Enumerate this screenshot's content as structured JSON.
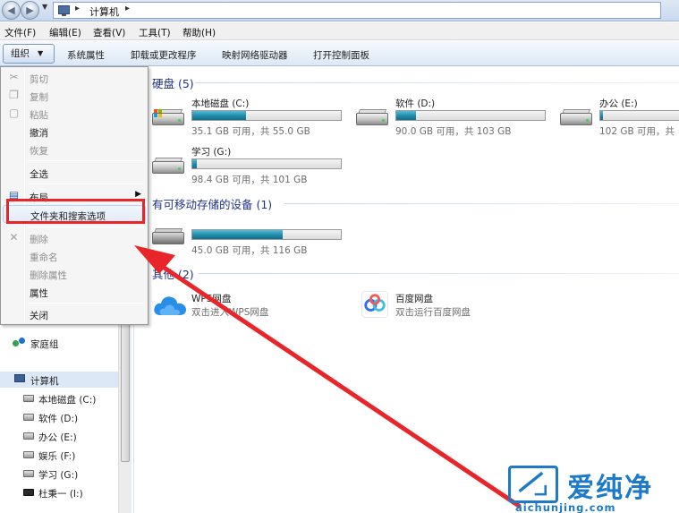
{
  "address_bar": {
    "location": "计算机",
    "separator": "▸"
  },
  "menubar": {
    "items": [
      "文件(F)",
      "编辑(E)",
      "查看(V)",
      "工具(T)",
      "帮助(H)"
    ]
  },
  "toolbar": {
    "organize_label": "组织",
    "buttons": [
      "系统属性",
      "卸载或更改程序",
      "映射网络驱动器",
      "打开控制面板"
    ]
  },
  "context_menu": {
    "items": [
      {
        "label": "剪切",
        "enabled": false,
        "icon": "scissors-icon"
      },
      {
        "label": "复制",
        "enabled": false,
        "icon": "copy-icon"
      },
      {
        "label": "粘贴",
        "enabled": false,
        "icon": "paste-icon"
      },
      {
        "label": "撤消",
        "enabled": true
      },
      {
        "label": "恢复",
        "enabled": false
      },
      {
        "label": "全选",
        "enabled": true
      },
      {
        "label": "布局",
        "enabled": true,
        "submenu": true,
        "icon": "layout-icon"
      },
      {
        "label": "文件夹和搜索选项",
        "enabled": true,
        "highlighted": true
      },
      {
        "label": "删除",
        "enabled": false,
        "icon": "delete-icon"
      },
      {
        "label": "重命名",
        "enabled": false
      },
      {
        "label": "删除属性",
        "enabled": false
      },
      {
        "label": "属性",
        "enabled": true
      },
      {
        "label": "关闭",
        "enabled": true
      }
    ]
  },
  "nav_pane": {
    "homegroup": "家庭组",
    "computer": "计算机",
    "drives": [
      {
        "label": "本地磁盘 (C:)"
      },
      {
        "label": "软件 (D:)"
      },
      {
        "label": "办公 (E:)"
      },
      {
        "label": "娱乐 (F:)"
      },
      {
        "label": "学习 (G:)"
      },
      {
        "label": "杜秉一 (I:)"
      }
    ]
  },
  "content": {
    "hard_disks": {
      "header": "硬盘 (5)",
      "drives": [
        {
          "name": "本地磁盘 (C:)",
          "capacity": "35.1 GB 可用，共 55.0 GB",
          "used_fraction": 0.36,
          "system": true
        },
        {
          "name": "软件 (D:)",
          "capacity": "90.0 GB 可用，共 103 GB",
          "used_fraction": 0.13
        },
        {
          "name": "办公 (E:)",
          "capacity": "102 GB 可用，共 ",
          "used_fraction": 0.02
        },
        {
          "name": "学习 (G:)",
          "capacity": "98.4 GB 可用，共 101 GB",
          "used_fraction": 0.03
        }
      ]
    },
    "removable": {
      "header": "有可移动存储的设备 (1)",
      "drives": [
        {
          "name": "",
          "capacity": "45.0 GB 可用，共 116 GB",
          "used_fraction": 0.61
        }
      ]
    },
    "other": {
      "header": "其他 (2)",
      "apps": [
        {
          "title": "WPS网盘",
          "desc": "双击进入WPS网盘",
          "icon": "cloud-icon"
        },
        {
          "title": "百度网盘",
          "desc": "双击运行百度网盘",
          "icon": "baidu-netdisk-icon"
        }
      ]
    }
  },
  "watermark": {
    "text": "爱纯净",
    "url": "aichunjing.com"
  },
  "colors": {
    "annotation_red": "#e8262a",
    "drive_bar": "#1e8aa9",
    "section_header": "#1e3287",
    "watermark_blue": "#1c7ac8"
  }
}
